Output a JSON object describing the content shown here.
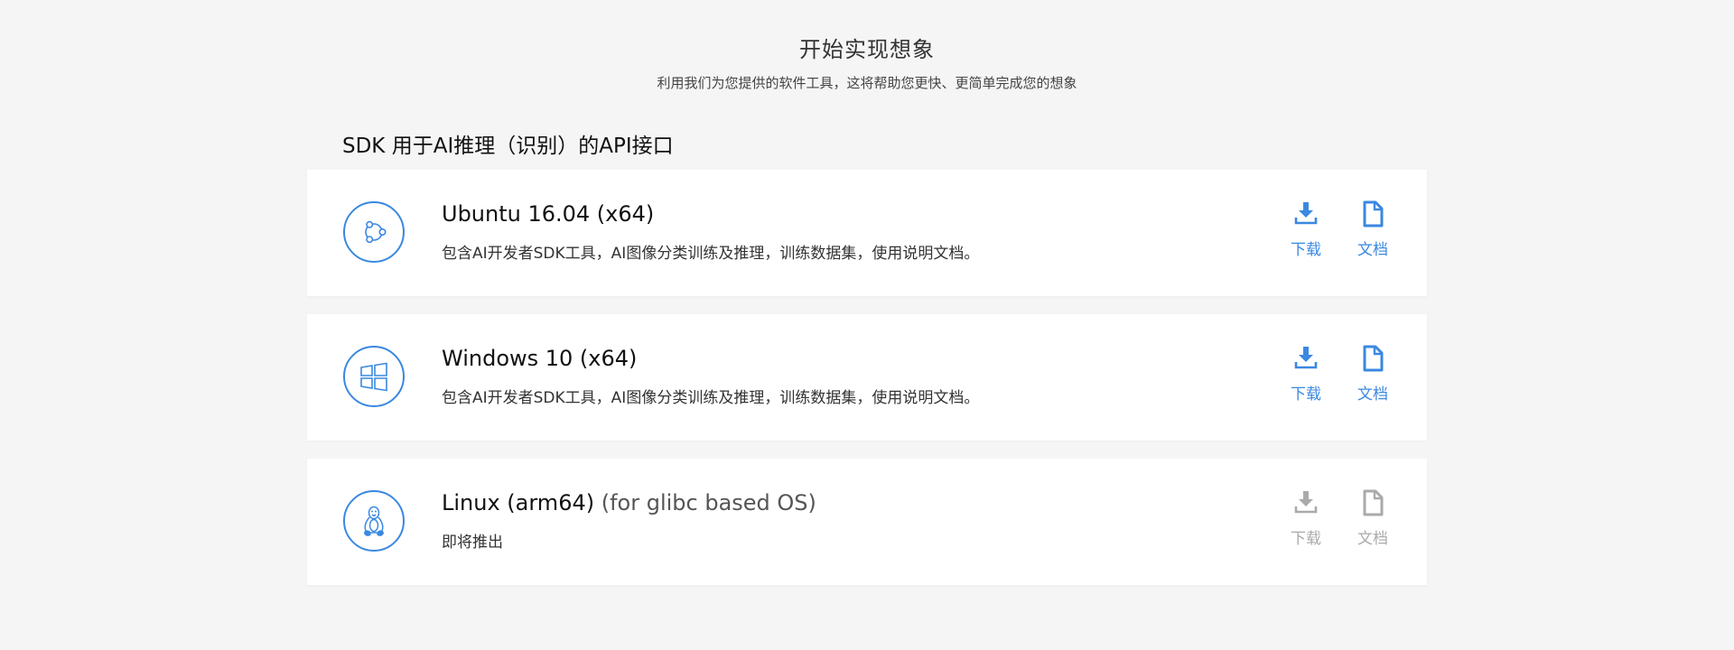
{
  "header": {
    "title": "开始实现想象",
    "subtitle": "利用我们为您提供的软件工具，这将帮助您更快、更简单完成您的想象"
  },
  "section": {
    "title": "SDK 用于AI推理（识别）的API接口"
  },
  "colors": {
    "accent": "#3a88e0",
    "disabled": "#aaaaaa",
    "background": "#f5f5f5"
  },
  "sdks": [
    {
      "icon": "ubuntu-icon",
      "title": "Ubuntu 16.04 (x64)",
      "title_suffix": "",
      "description": "包含AI开发者SDK工具，AI图像分类训练及推理，训练数据集，使用说明文档。",
      "download_label": "下载",
      "docs_label": "文档",
      "enabled": true
    },
    {
      "icon": "windows-icon",
      "title": "Windows 10 (x64)",
      "title_suffix": "",
      "description": "包含AI开发者SDK工具，AI图像分类训练及推理，训练数据集，使用说明文档。",
      "download_label": "下载",
      "docs_label": "文档",
      "enabled": true
    },
    {
      "icon": "linux-icon",
      "title": "Linux (arm64)",
      "title_suffix": " (for glibc based OS)",
      "description": "即将推出",
      "download_label": "下载",
      "docs_label": "文档",
      "enabled": false
    }
  ]
}
